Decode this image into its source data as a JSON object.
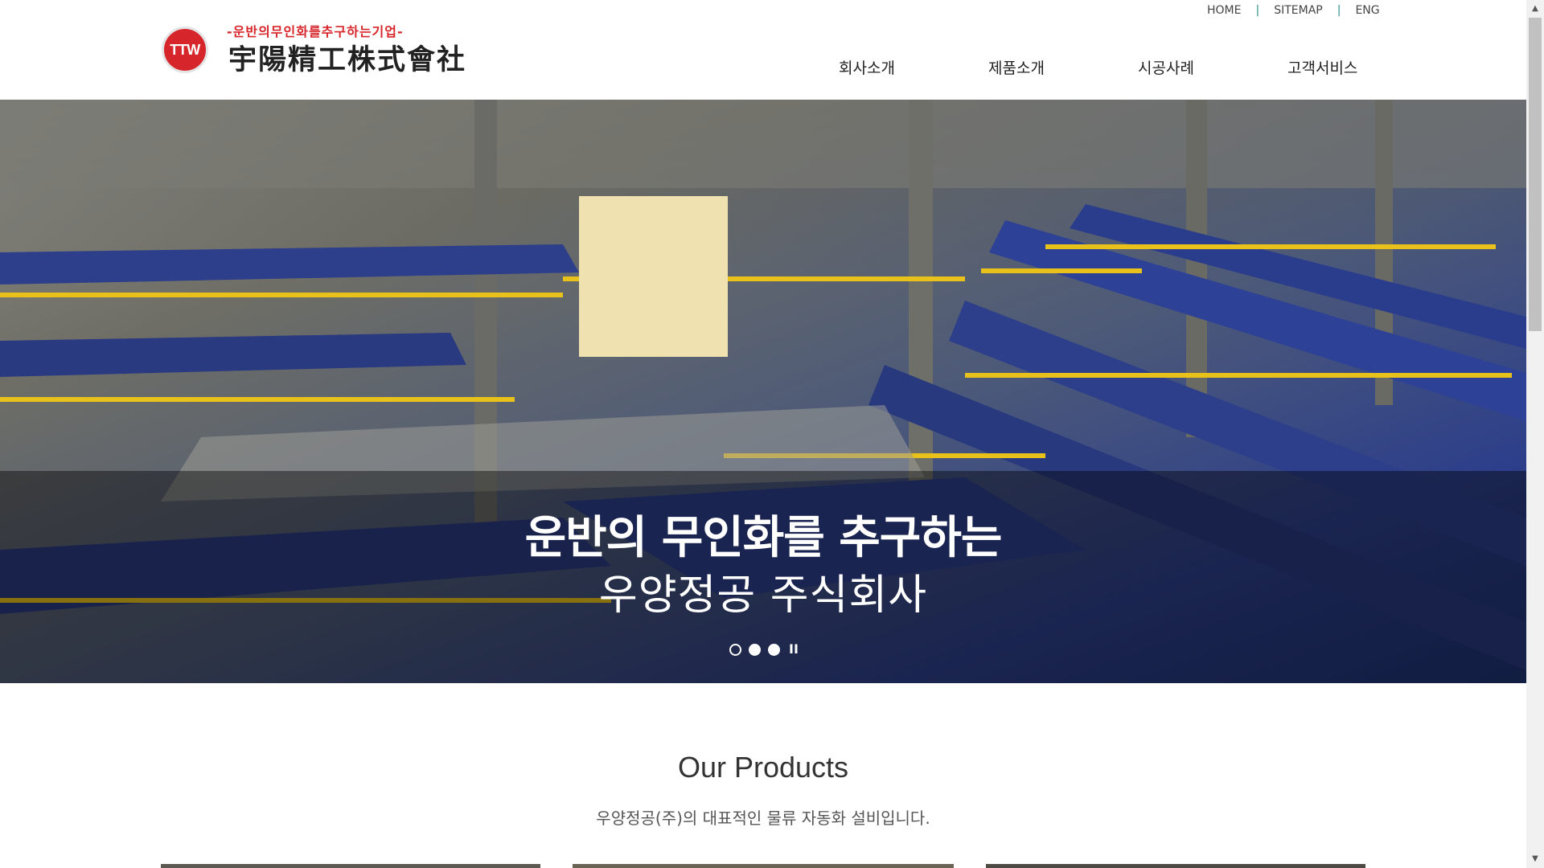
{
  "logo": {
    "mark": "TTW",
    "slogan": "-운반의무인화를추구하는기업-",
    "name": "宇陽精工株式會社"
  },
  "util_nav": {
    "home": "HOME",
    "sep": "|",
    "sitemap": "SITEMAP",
    "eng": "ENG"
  },
  "gnb": [
    {
      "label": "회사소개"
    },
    {
      "label": "제품소개"
    },
    {
      "label": "시공사례"
    },
    {
      "label": "고객서비스"
    }
  ],
  "hero": {
    "title": "운반의 무인화를 추구하는",
    "subtitle": "우양정공 주식회사",
    "slides_total": 3,
    "active_slide": 1,
    "pause_label": "II"
  },
  "products": {
    "title": "Our Products",
    "subtitle": "우양정공(주)의 대표적인 물류 자동화 설비입니다."
  },
  "colors": {
    "brand_red": "#d7262b",
    "conveyor_blue": "#2d3f8a",
    "rail_yellow": "#e8c21a"
  }
}
